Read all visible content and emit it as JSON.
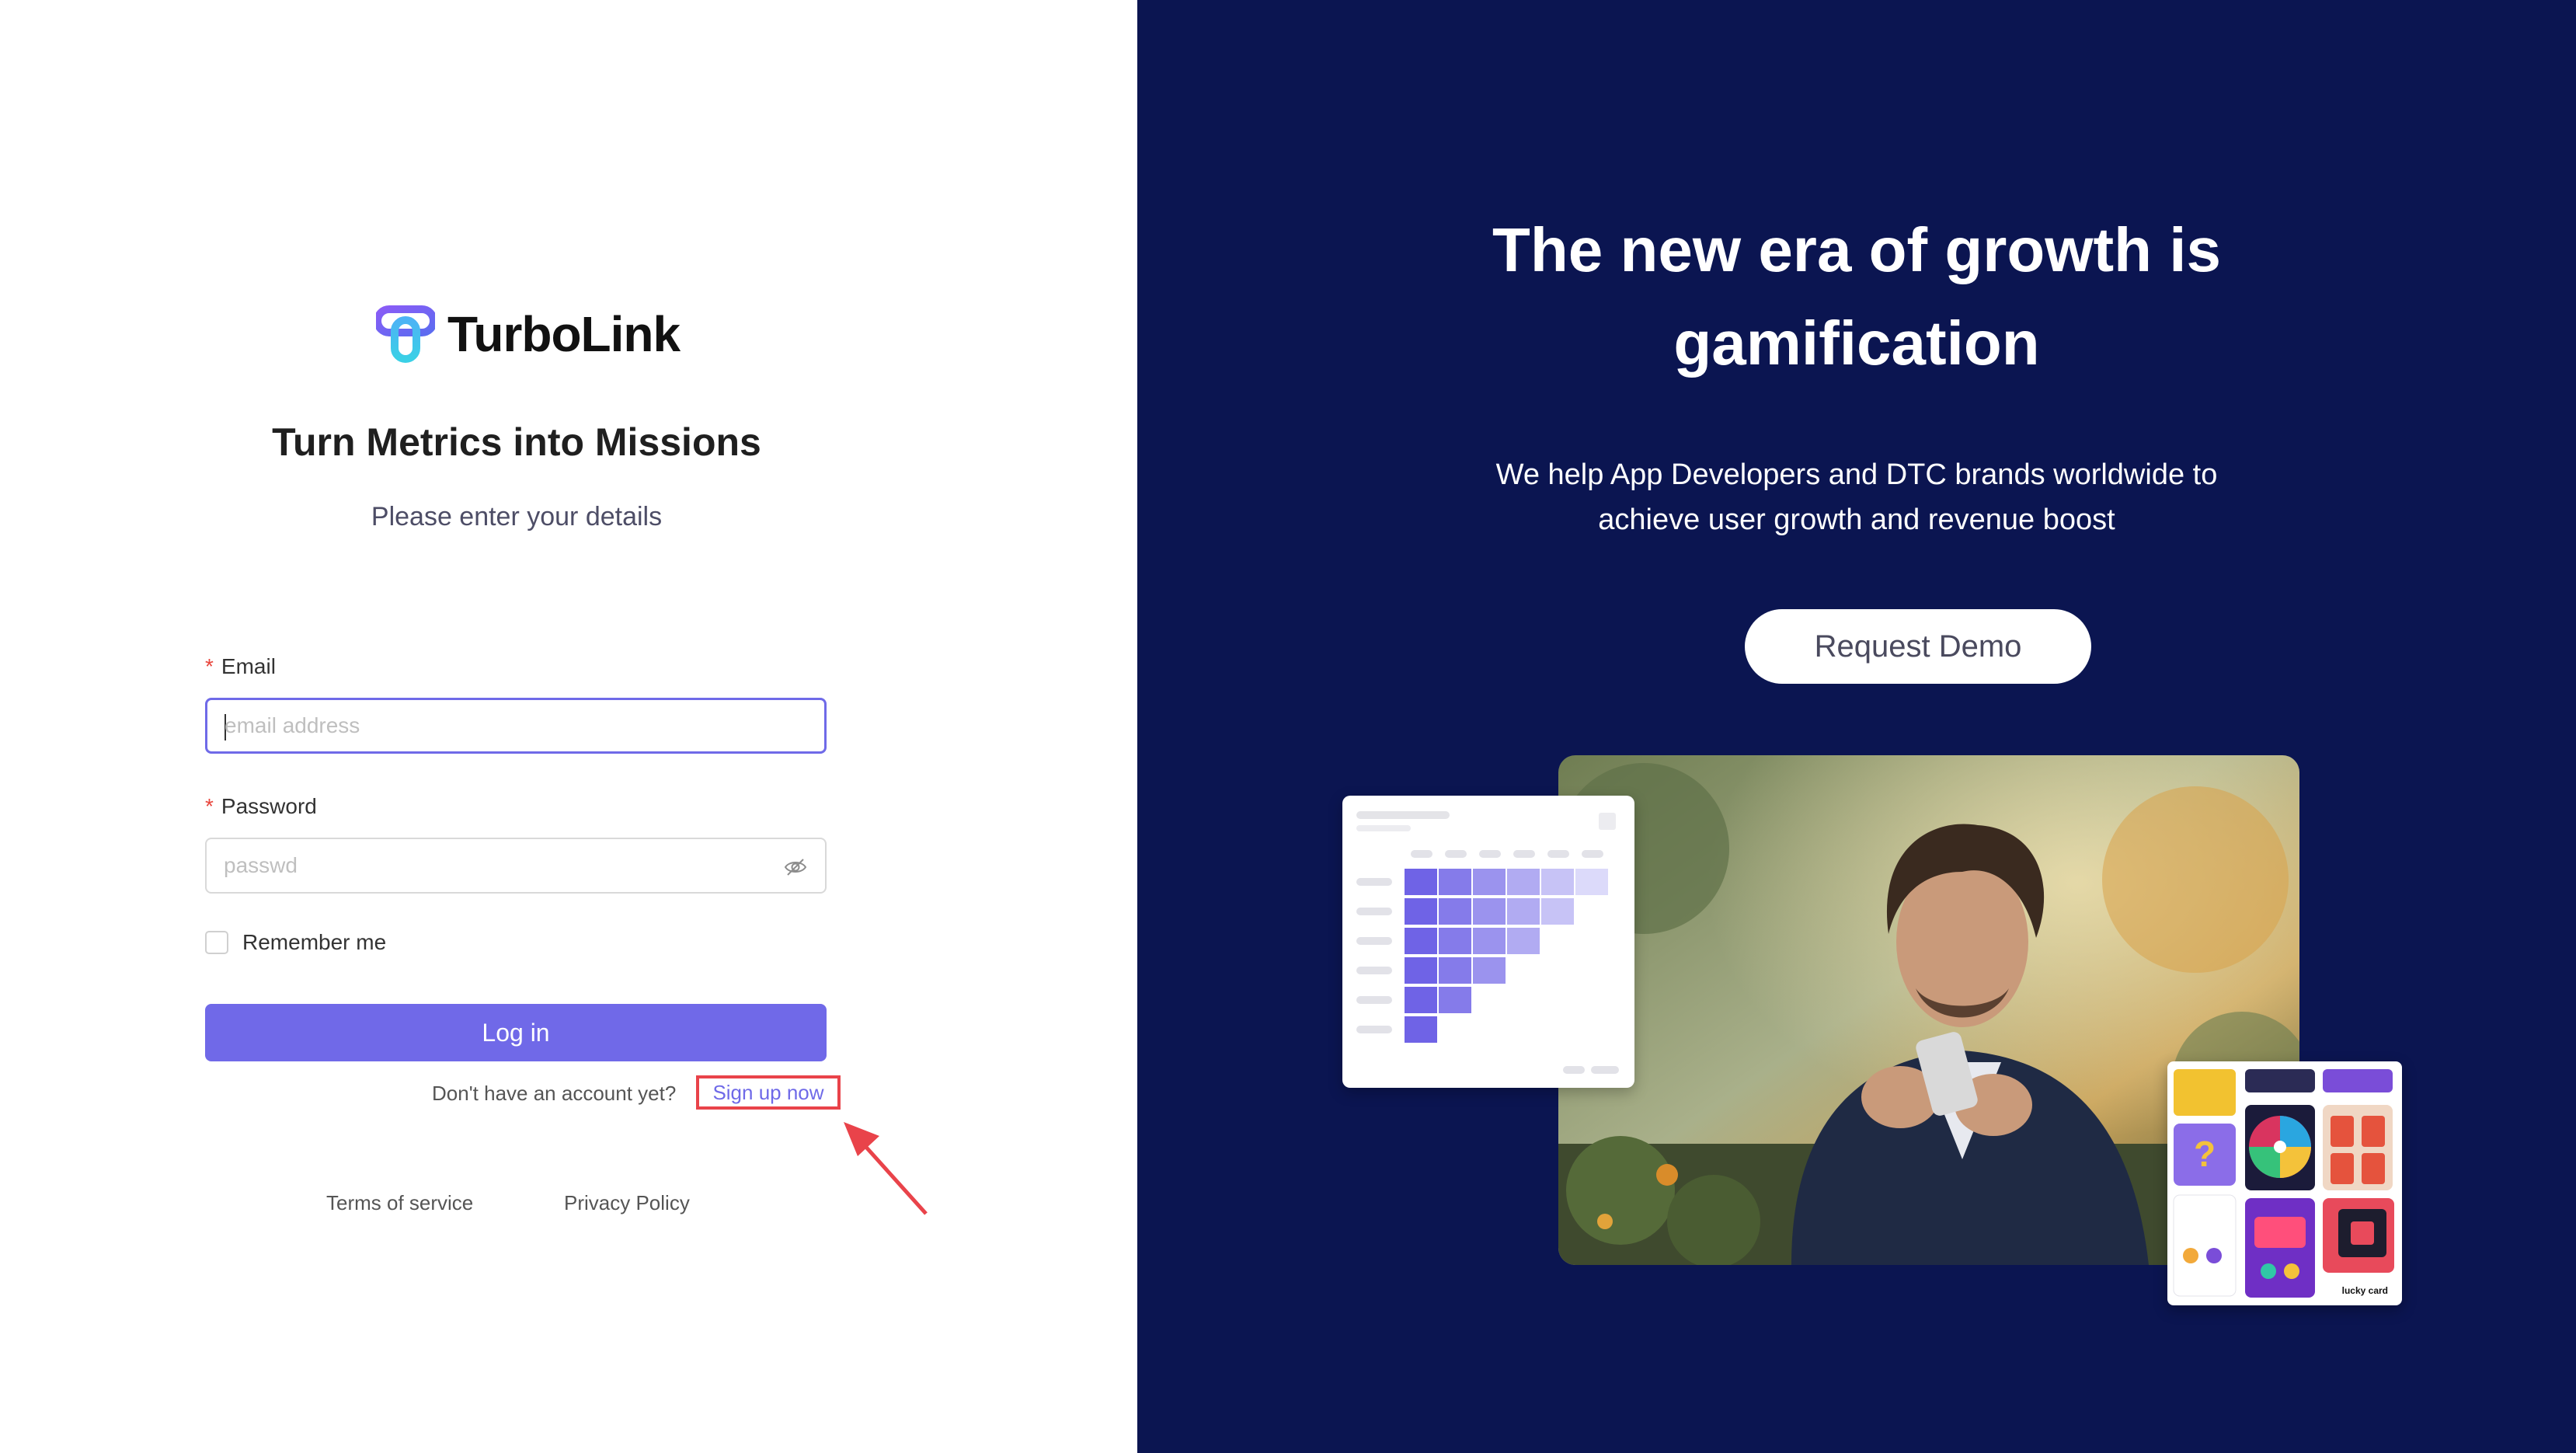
{
  "brand": {
    "name": "TurboLink",
    "logo_icon": "turbolink-logo-icon"
  },
  "login": {
    "heading": "Turn Metrics into Missions",
    "subheading": "Please enter your details",
    "email_label": "Email",
    "email_placeholder": "email address",
    "password_label": "Password",
    "password_placeholder": "passwd",
    "required_mark": "*",
    "remember_label": "Remember me",
    "login_button": "Log in",
    "no_account_text": "Don't have an account yet?",
    "signup_link": "Sign up now",
    "footer": {
      "terms": "Terms of service",
      "privacy": "Privacy Policy"
    }
  },
  "hero": {
    "title_line1": "The new era of growth is",
    "title_line2": "gamification",
    "text_line1": "We help App Developers and DTC brands worldwide to",
    "text_line2": "achieve user growth and revenue boost",
    "demo_button": "Request Demo",
    "games_card_caption": "lucky card"
  },
  "colors": {
    "primary": "#7069e8",
    "right_bg": "#0b1551",
    "highlight": "#e9434a"
  }
}
